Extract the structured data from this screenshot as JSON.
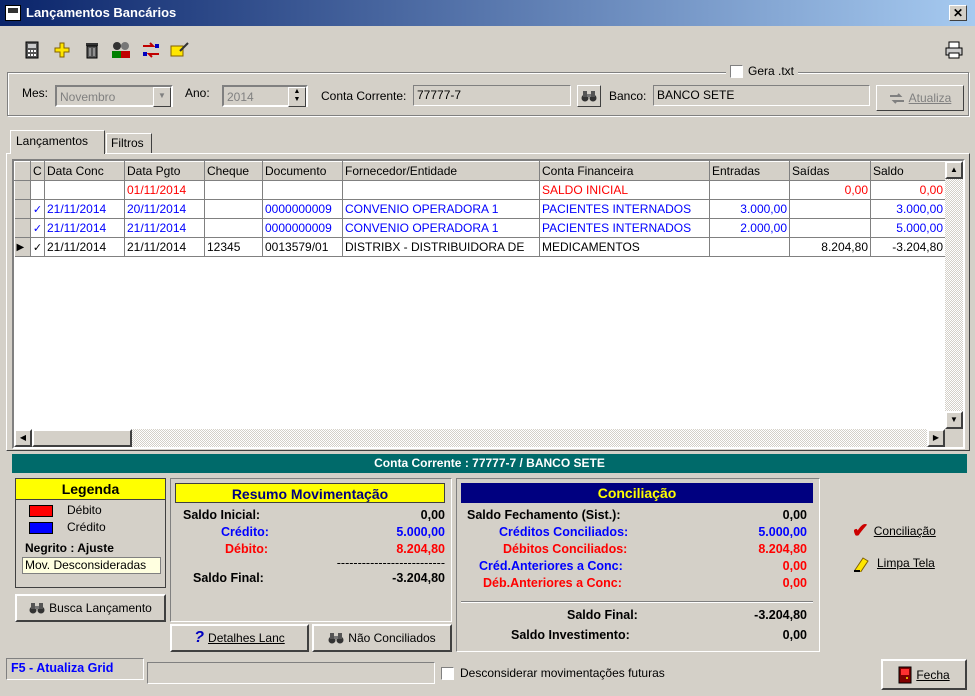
{
  "window": {
    "title": "Lançamentos Bancários",
    "close_glyph": "✕"
  },
  "filters": {
    "gera_txt_label": "Gera .txt",
    "mes_label": "Mes:",
    "mes_value": "Novembro",
    "ano_label": "Ano:",
    "ano_value": "2014",
    "conta_label": "Conta Corrente:",
    "conta_value": "77777-7",
    "banco_label": "Banco:",
    "banco_value": "BANCO SETE",
    "atualiza_label": "Atualiza"
  },
  "tabs": [
    {
      "label": "Lançamentos"
    },
    {
      "label": "Filtros"
    }
  ],
  "grid": {
    "headers": [
      "C",
      "Data Conc",
      "Data Pgto",
      "Cheque",
      "Documento",
      "Fornecedor/Entidade",
      "Conta Financeira",
      "Entradas",
      "Saídas",
      "Saldo"
    ],
    "rows": [
      {
        "c": "",
        "data_conc": "",
        "data_pgto": "01/11/2014",
        "cheque": "",
        "documento": "",
        "fornecedor": "",
        "conta": "SALDO INICIAL",
        "entradas": "",
        "saidas": "0,00",
        "saldo": "0,00",
        "color": "#ff0000"
      },
      {
        "c": "✓",
        "data_conc": "21/11/2014",
        "data_pgto": "20/11/2014",
        "cheque": "",
        "documento": "0000000009",
        "fornecedor": "CONVENIO OPERADORA 1",
        "conta": "PACIENTES INTERNADOS",
        "entradas": "3.000,00",
        "saidas": "",
        "saldo": "3.000,00",
        "color": "#0000ff"
      },
      {
        "c": "✓",
        "data_conc": "21/11/2014",
        "data_pgto": "21/11/2014",
        "cheque": "",
        "documento": "0000000009",
        "fornecedor": "CONVENIO OPERADORA 1",
        "conta": "PACIENTES INTERNADOS",
        "entradas": "2.000,00",
        "saidas": "",
        "saldo": "5.000,00",
        "color": "#0000ff"
      },
      {
        "c": "✓",
        "data_conc": "21/11/2014",
        "data_pgto": "21/11/2014",
        "cheque": "12345",
        "documento": "0013579/01",
        "fornecedor": "DISTRIBX - DISTRIBUIDORA DE",
        "conta": "MEDICAMENTOS",
        "entradas": "",
        "saidas": "8.204,80",
        "saldo": "-3.204,80",
        "color": "#000000"
      }
    ]
  },
  "account_banner": "Conta Corrente : 77777-7 / BANCO SETE",
  "legenda": {
    "title": "Legenda",
    "debito": "Débito",
    "credito": "Crédito",
    "negrito": "Negrito : Ajuste",
    "mov_desc": "Mov. Desconsideradas",
    "debito_color": "#ff0000",
    "credito_color": "#0000ff"
  },
  "busca_label": "Busca Lançamento",
  "resumo": {
    "title": "Resumo Movimentação",
    "saldo_inicial_label": "Saldo Inicial:",
    "saldo_inicial": "0,00",
    "credito_label": "Crédito:",
    "credito": "5.000,00",
    "debito_label": "Débito:",
    "debito": "8.204,80",
    "dashes": "--------------------------",
    "saldo_final_label": "Saldo Final:",
    "saldo_final": "-3.204,80"
  },
  "conciliacao": {
    "title": "Conciliação",
    "fech_label": "Saldo Fechamento (Sist.):",
    "fech": "0,00",
    "cred_conc_label": "Créditos Conciliados:",
    "cred_conc": "5.000,00",
    "deb_conc_label": "Débitos Conciliados:",
    "deb_conc": "8.204,80",
    "cred_ant_label": "Créd.Anteriores a Conc:",
    "cred_ant": "0,00",
    "deb_ant_label": "Déb.Anteriores a Conc:",
    "deb_ant": "0,00",
    "saldo_final_label": "Saldo Final:",
    "saldo_final": "-3.204,80",
    "saldo_inv_label": "Saldo Investimento:",
    "saldo_inv": "0,00"
  },
  "detalhes_label": "Detalhes Lanc",
  "nao_conc_label": "Não Conciliados",
  "conciliacao_btn": "Conciliação",
  "limpa_btn": "Limpa Tela",
  "status": {
    "f5": "F5 - Atualiza Grid",
    "desconsiderar": "Desconsiderar movimentações futuras"
  },
  "fecha_label": "Fecha"
}
